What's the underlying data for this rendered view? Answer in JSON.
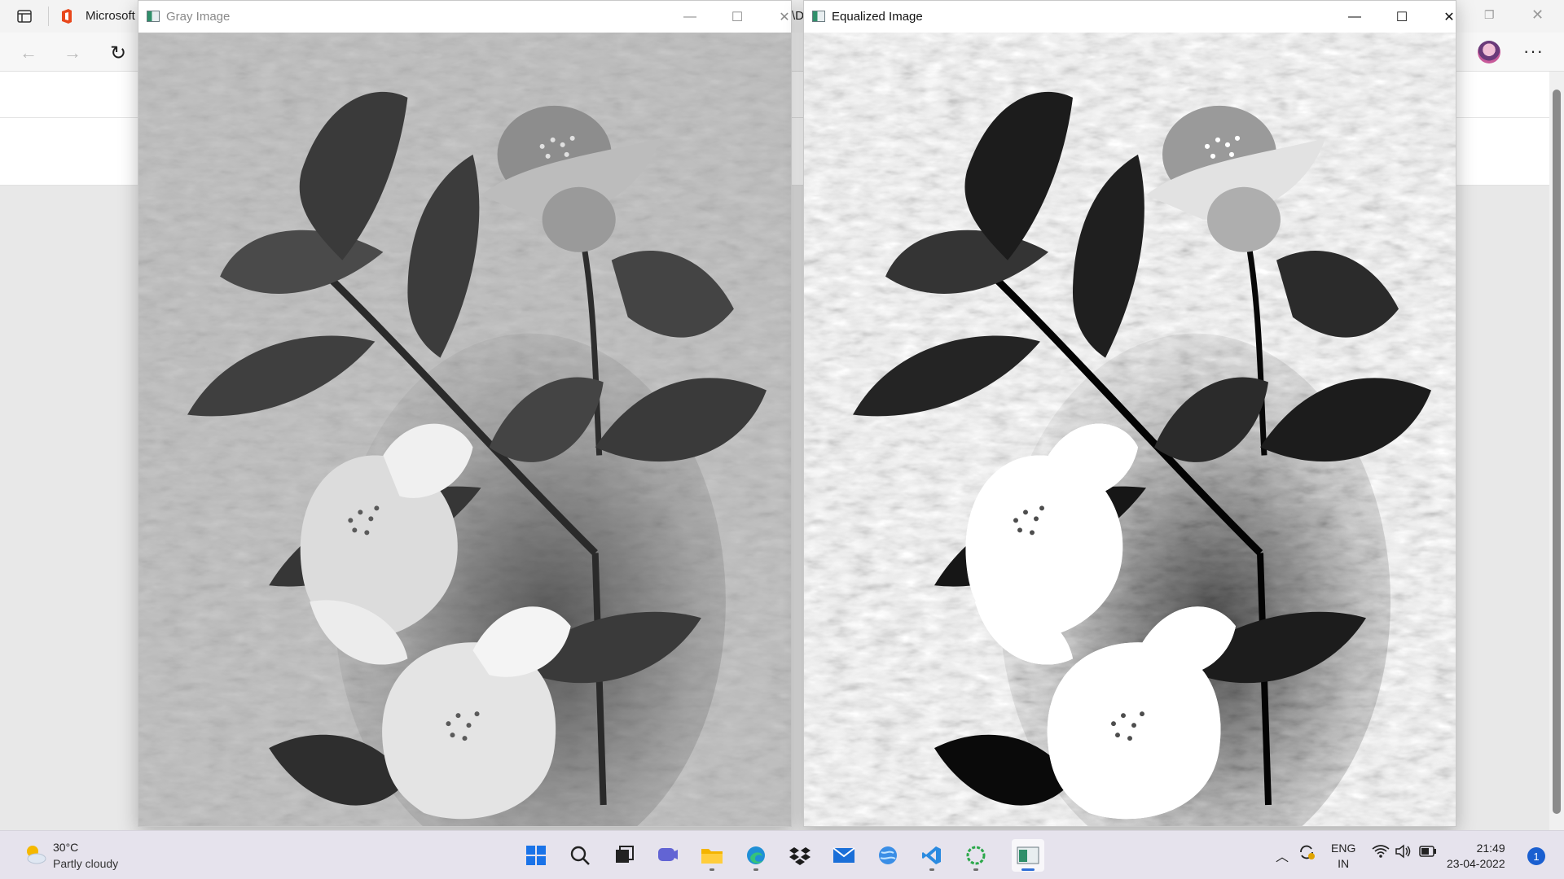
{
  "browser": {
    "tab_title": "Microsoft",
    "peek_text": "\\D",
    "icons": [
      "sidebar-icon",
      "office-icon",
      "back-arrow-icon",
      "forward-arrow-icon",
      "refresh-icon",
      "profile-avatar",
      "more-menu-icon"
    ]
  },
  "windows": [
    {
      "title": "Gray Image",
      "state": "inactive",
      "controls": {
        "minimize": "—",
        "maximize": "☐",
        "close": "✕"
      }
    },
    {
      "title": "Equalized Image",
      "state": "active",
      "controls": {
        "minimize": "—",
        "maximize": "☐",
        "close": "✕"
      }
    }
  ],
  "taskbar": {
    "weather": {
      "temp": "30°C",
      "desc": "Partly cloudy"
    },
    "apps": [
      "start",
      "search",
      "task-view",
      "teams-chat",
      "file-explorer",
      "edge",
      "dropbox",
      "mail",
      "globe-app",
      "vs-code",
      "circle-app",
      "python-opencv"
    ],
    "language": {
      "line1": "ENG",
      "line2": "IN"
    },
    "clock": {
      "time": "21:49",
      "date": "23-04-2022"
    },
    "notifications": "1"
  },
  "colors": {
    "accent": "#2f6fd6",
    "taskbar_bg": "#e6e3ed"
  }
}
